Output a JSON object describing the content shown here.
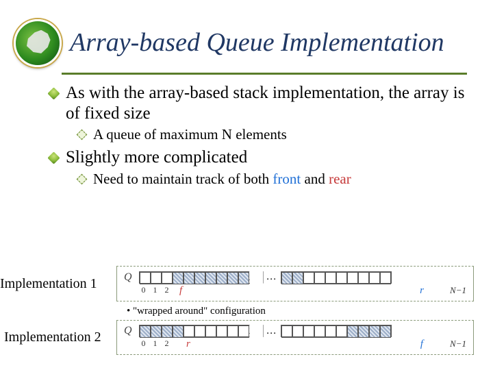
{
  "title": "Array-based Queue Implementation",
  "bullets": {
    "b1": "As with the array-based stack implementation, the array is of fixed size",
    "b1a": "A queue of maximum N elements",
    "b2": "Slightly  more complicated",
    "b2a_prefix": "Need to maintain track of both ",
    "b2a_front": "front",
    "b2a_mid": " and ",
    "b2a_rear": "rear"
  },
  "impl1_label": "Implementation 1",
  "impl2_label": "Implementation 2",
  "wrap_text": "\"wrapped around\" configuration",
  "diagram": {
    "q_label": "Q",
    "dots": "…",
    "idx0": "0",
    "idx1": "1",
    "idx2": "2",
    "f": "f",
    "r": "r",
    "Nminus1": "N−1"
  }
}
